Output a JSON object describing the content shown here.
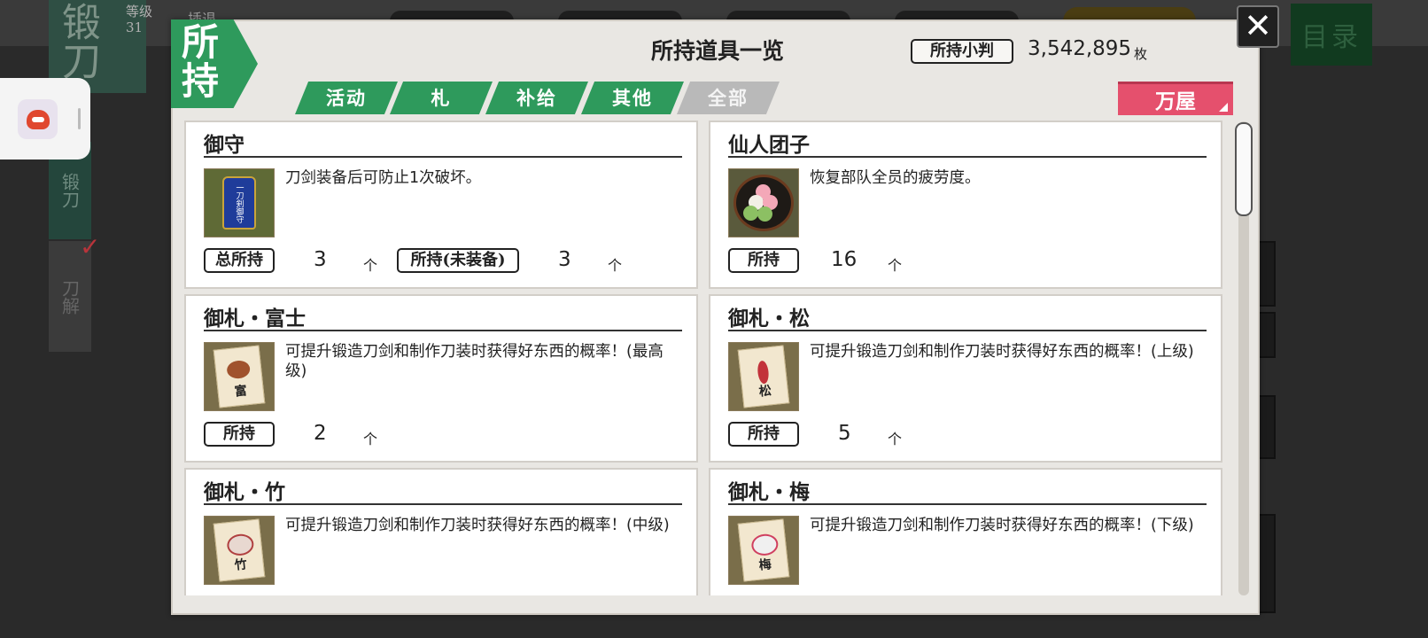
{
  "background": {
    "forge_title": "锻刀",
    "level_label": "等级",
    "level_value": "31",
    "player_tag": "插退",
    "side_forge": "锻刀",
    "side_dismantle": "刀解",
    "menu_label": "目录"
  },
  "modal": {
    "badge": "所持",
    "title": "所持道具一览",
    "koban_label": "所持小判",
    "koban_value": "3,542,895",
    "koban_unit": "枚",
    "close_glyph": "✕",
    "shop_button": "万屋",
    "tabs": [
      {
        "label": "活动",
        "active": true
      },
      {
        "label": "札",
        "active": true
      },
      {
        "label": "补给",
        "active": true
      },
      {
        "label": "其他",
        "active": true
      },
      {
        "label": "全部",
        "active": false
      }
    ]
  },
  "items": [
    {
      "name": "御守",
      "icon": "omamori-icon",
      "icon_text": "一刀剣御守",
      "description": "刀剑装备后可防止1次破坏。",
      "counts": [
        {
          "label": "总所持",
          "value": "3",
          "unit": "个"
        },
        {
          "label": "所持(未装备)",
          "value": "3",
          "unit": "个"
        }
      ]
    },
    {
      "name": "仙人团子",
      "icon": "dango-icon",
      "description": "恢复部队全员的疲劳度。",
      "counts": [
        {
          "label": "所持",
          "value": "16",
          "unit": "个"
        }
      ]
    },
    {
      "name": "御札・富士",
      "icon": "fuda-fuji-icon",
      "icon_char": "富",
      "description": "可提升锻造刀剑和制作刀装时获得好东西的概率！(最高级)",
      "counts": [
        {
          "label": "所持",
          "value": "2",
          "unit": "个"
        }
      ]
    },
    {
      "name": "御札・松",
      "icon": "fuda-matsu-icon",
      "icon_char": "松",
      "description": "可提升锻造刀剑和制作刀装时获得好东西的概率！(上级)",
      "counts": [
        {
          "label": "所持",
          "value": "5",
          "unit": "个"
        }
      ]
    },
    {
      "name": "御札・竹",
      "icon": "fuda-take-icon",
      "icon_char": "竹",
      "description": "可提升锻造刀剑和制作刀装时获得好东西的概率！(中级)",
      "counts": []
    },
    {
      "name": "御札・梅",
      "icon": "fuda-ume-icon",
      "icon_char": "梅",
      "description": "可提升锻造刀剑和制作刀装时获得好东西的概率！(下级)",
      "counts": []
    }
  ],
  "colors": {
    "tab_green": "#2e9a5c",
    "tab_inactive": "#b9b9b9",
    "shop_pink": "#e5506d"
  }
}
